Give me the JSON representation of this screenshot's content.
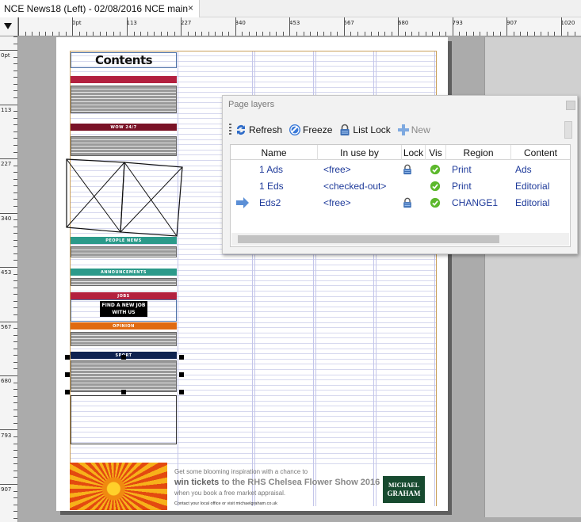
{
  "window": {
    "tab_title": "NCE News18 (Left) - 02/08/2016 NCE main",
    "tab_close": "×"
  },
  "ruler": {
    "horizontal_labels": [
      "0pt",
      "113",
      "227",
      "340",
      "453",
      "567",
      "680",
      "793",
      "907",
      "1020"
    ],
    "vertical_labels": [
      "0pt",
      "113",
      "227",
      "340",
      "453",
      "567",
      "680",
      "793",
      "907"
    ]
  },
  "page": {
    "contents_title": "Contents",
    "sections": [
      {
        "label": "",
        "color": "#b3203f"
      },
      {
        "label": "WOW 24/7",
        "color": "#7a1226"
      },
      {
        "label": "PEOPLE NEWS",
        "color": "#2b9a8a"
      },
      {
        "label": "ANNOUNCEMENTS",
        "color": "#2b9a8a"
      },
      {
        "label": "JOBS",
        "color": "#b3203f"
      },
      {
        "label": "OPINION",
        "color": "#e06a10"
      },
      {
        "label": "SPORT",
        "color": "#0f2350"
      }
    ],
    "find_job_line1": "FIND A NEW JOB",
    "find_job_line2": "WITH US"
  },
  "advert": {
    "line1": "Get some blooming inspiration with a chance to",
    "line2_bold": "win tickets",
    "line2_rest": "to the RHS Chelsea Flower Show 2016",
    "line3": "when you book a free market appraisal.",
    "line4": "Contact your local office or visit michaelgraham.co.uk",
    "logo_line1": "MICHAEL",
    "logo_line2": "GRAHAM"
  },
  "layers_panel": {
    "title": "Page layers",
    "toolbar": {
      "refresh": "Refresh",
      "freeze": "Freeze",
      "list_lock": "List Lock",
      "new": "New"
    },
    "columns": [
      "Name",
      "In use by",
      "Lock",
      "Vis",
      "Region",
      "Content"
    ],
    "rows": [
      {
        "name": "1 Ads",
        "in_use_by": "<free>",
        "locked": true,
        "visible": true,
        "region": "Print",
        "content": "Ads",
        "current": false
      },
      {
        "name": "1 Eds",
        "in_use_by": "<checked-out>",
        "locked": false,
        "visible": true,
        "region": "Print",
        "content": "Editorial",
        "current": false
      },
      {
        "name": "Eds2",
        "in_use_by": "<free>",
        "locked": true,
        "visible": true,
        "region": "CHANGE1",
        "content": "Editorial",
        "current": true
      }
    ],
    "colors": {
      "cell_text": "#1e3a9a",
      "vis_green": "#5cb82c",
      "lock_blue": "#3e6fb5",
      "arrow_blue": "#5b8fd6"
    }
  }
}
